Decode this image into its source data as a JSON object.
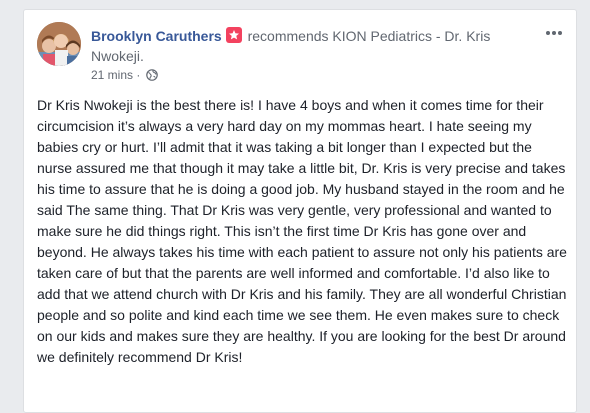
{
  "post": {
    "author": "Brooklyn Caruthers",
    "recommends_text": "recommends",
    "page_name": "KION Pediatrics - Dr. Kris Nwokeji.",
    "timestamp": "21 mins",
    "separator": " · ",
    "body": "Dr Kris Nwokeji is the best there is! I have 4 boys and when it comes time for their circumcision it’s always a very hard day on my mommas heart. I hate seeing my babies cry or hurt. I’ll admit that it was taking a bit longer than I expected but the nurse assured me that though it may take a little bit, Dr. Kris is very precise and takes his time to assure that he is doing a good job. My husband stayed in the room and he said The same thing. That Dr Kris was very gentle, very professional and wanted to make sure he did things right. This isn’t the first time Dr Kris has gone over and beyond. He always takes his time with each patient to assure not only his patients are taken care of but that the parents are well informed and comfortable. I’d also like to add that we attend church with Dr Kris and his family. They are all wonderful Christian people and so polite and kind each time we see them. He even makes sure to check on our kids and makes sure they are healthy. If you are looking for the best Dr around we definitely recommend Dr Kris!",
    "icons": {
      "recommend": "recommend-star-icon",
      "privacy": "globe-icon",
      "menu": "more-options-icon"
    },
    "colors": {
      "author": "#385898",
      "recommend_badge": "#f3425f",
      "meta_text": "#616770",
      "body_text": "#1d2129",
      "background": "#e9ebee"
    }
  }
}
